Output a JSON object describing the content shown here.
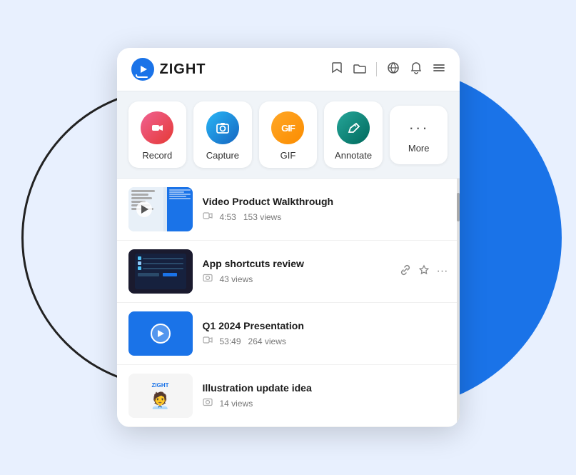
{
  "app": {
    "name": "ZIGHT"
  },
  "header": {
    "bookmark_icon": "★",
    "folder_icon": "□",
    "globe_icon": "🌐",
    "bell_icon": "🔔",
    "menu_icon": "☰"
  },
  "toolbar": {
    "items": [
      {
        "id": "record",
        "label": "Record",
        "icon_class": "icon-record",
        "icon_char": "⏺"
      },
      {
        "id": "capture",
        "label": "Capture",
        "icon_class": "icon-capture",
        "icon_char": "📷"
      },
      {
        "id": "gif",
        "label": "GIF",
        "icon_class": "icon-gif",
        "icon_char": "GIF"
      },
      {
        "id": "annotate",
        "label": "Annotate",
        "icon_class": "icon-annotate",
        "icon_char": "✏"
      },
      {
        "id": "more",
        "label": "More",
        "icon_char": "···"
      }
    ]
  },
  "list": {
    "items": [
      {
        "id": "item1",
        "title": "Video Product Walkthrough",
        "type": "video",
        "duration": "4:53",
        "views": "153 views",
        "thumb_type": "1"
      },
      {
        "id": "item2",
        "title": "App shortcuts review",
        "type": "capture",
        "views": "43 views",
        "thumb_type": "2"
      },
      {
        "id": "item3",
        "title": "Q1 2024 Presentation",
        "type": "video",
        "duration": "53:49",
        "views": "264 views",
        "thumb_type": "3"
      },
      {
        "id": "item4",
        "title": "Illustration update idea",
        "type": "capture",
        "views": "14 views",
        "thumb_type": "4"
      }
    ]
  }
}
